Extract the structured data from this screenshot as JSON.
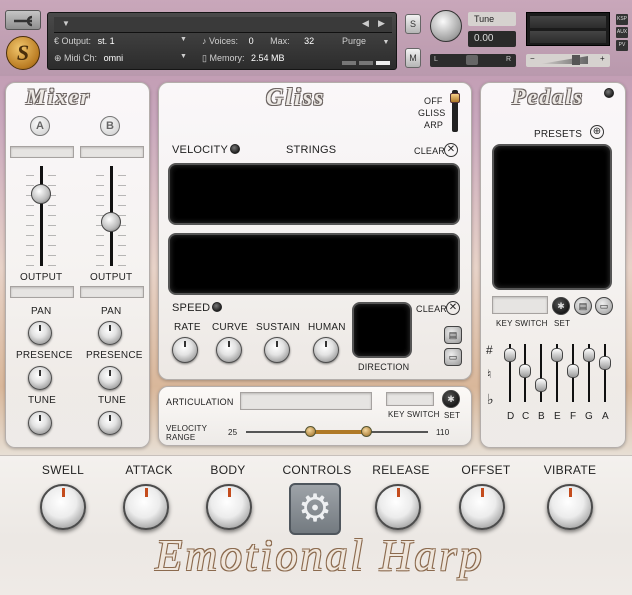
{
  "header": {
    "output_label": "Output:",
    "output_value": "st. 1",
    "midi_label": "Midi Ch:",
    "midi_value": "omni",
    "voices_label": "Voices:",
    "voices_value": "0",
    "max_label": "Max:",
    "max_value": "32",
    "purge_label": "Purge",
    "memory_label": "Memory:",
    "memory_value": "2.54 MB",
    "solo_label": "S",
    "mute_label": "M",
    "tune_label": "Tune",
    "tune_value": "0.00",
    "pan_left": "L",
    "pan_right": "R",
    "side_buttons": [
      "KSP",
      "AUX",
      "PV"
    ]
  },
  "mixer": {
    "title": "Mixer",
    "channel_a": "A",
    "channel_b": "B",
    "output_label": "OUTPUT",
    "pan_label": "PAN",
    "presence_label": "PRESENCE",
    "tune_label": "TUNE"
  },
  "gliss": {
    "title": "Gliss",
    "mode_options": [
      "OFF",
      "GLISS",
      "ARP"
    ],
    "velocity_label": "VELOCITY",
    "strings_label": "STRINGS",
    "clear_label": "CLEAR",
    "speed_label": "SPEED",
    "rate_label": "RATE",
    "curve_label": "CURVE",
    "sustain_label": "SUSTAIN",
    "human_label": "HUMAN",
    "direction_label": "DIRECTION"
  },
  "articulation": {
    "label": "ARTICULATION",
    "key_switch_label": "KEY SWITCH",
    "set_label": "SET",
    "velocity_range_label": "VELOCITY RANGE",
    "range_min": "25",
    "range_max": "110"
  },
  "pedals": {
    "title": "Pedals",
    "presets_label": "PRESETS",
    "key_switch_label": "KEY SWITCH",
    "set_label": "SET",
    "sharp_symbol": "#",
    "natural_symbol": "♮",
    "flat_symbol": "♭",
    "strings": [
      "D",
      "C",
      "B",
      "E",
      "F",
      "G",
      "A"
    ]
  },
  "controls": {
    "swell": "SWELL",
    "attack": "ATTACK",
    "body": "BODY",
    "controls": "CONTROLS",
    "release": "RELEASE",
    "offset": "OFFSET",
    "vibrate": "VIBRATE"
  },
  "brand": "Emotional Harp"
}
